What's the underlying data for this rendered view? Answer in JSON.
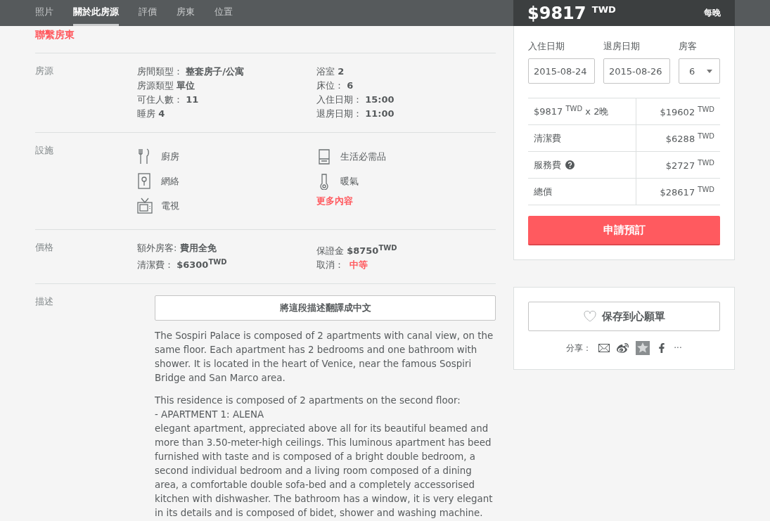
{
  "nav": {
    "tabs": [
      {
        "label": "照片",
        "selected": false
      },
      {
        "label": "關於此房源",
        "selected": true
      },
      {
        "label": "評價",
        "selected": false
      },
      {
        "label": "房東",
        "selected": false
      },
      {
        "label": "位置",
        "selected": false
      }
    ]
  },
  "contact_link": "聯繫房東",
  "sections": [
    {
      "kind": "details",
      "title": "房源",
      "columns": [
        [
          "房間類型： **整套房子/公寓**",
          "房源類型 **單位**",
          "可住人數： **11**",
          "睡房 **4**"
        ],
        [
          "浴室 **2**",
          "床位： **6**",
          "入住日期： **15:00**",
          "退房日期： **11:00**"
        ]
      ]
    },
    {
      "kind": "amenities",
      "title": "設施",
      "columns": [
        [
          {
            "kind": "kitchen",
            "label": "廚房"
          },
          {
            "kind": "internet",
            "label": "網絡"
          },
          {
            "kind": "tv",
            "label": "電視"
          }
        ],
        [
          {
            "kind": "essentials",
            "label": "生活必需品"
          },
          {
            "kind": "heating",
            "label": "暖氣"
          }
        ]
      ],
      "more": "更多內容"
    },
    {
      "kind": "prices",
      "title": "價格",
      "columns": [
        [
          {
            "text": "額外房客: **費用全免**"
          },
          {
            "text": "清潔費： **$6300$^{TWD}$**"
          }
        ],
        [
          {
            "text": "保證金 **$8750$^{TWD}$**"
          },
          {
            "text": "取消：",
            "highlight": "中等"
          }
        ]
      ]
    },
    {
      "kind": "description",
      "title": "描述",
      "translate_button": "將這段描述翻譯成中文",
      "paragraphs": [
        "The Sospiri Palace is composed of 2 apartments with canal view, on the same floor. Each apartment has 2 bedrooms and one bathroom with shower. It is located in the heart of Venice, near the famous Sospiri Bridge and San Marco area.",
        "This residence is composed of 2 apartments on the second floor:\n- APARTMENT 1: ALENA\nelegant apartment, appreciated above all for its beautiful beamed and more than 3.50-meter-high ceilings. This luminous apartment has beed furnished with taste and is composed of a bright double bedroom, a second individual bedroom and a living room composed of a dining area, a comfortable double sofa-bed and a completely accessorised kitchen with dishwasher. The bathroom has a window, it is very elegant in its details and is composed of bidet, shower and washing machine."
      ]
    }
  ],
  "booking": {
    "price": "$9817",
    "currency": "TWD",
    "per": "每晚",
    "fields": [
      {
        "kind": "date",
        "label": "入住日期",
        "value": "2015-08-24"
      },
      {
        "kind": "date",
        "label": "退房日期",
        "value": "2015-08-26"
      },
      {
        "kind": "select",
        "label": "房客",
        "value": "6"
      }
    ],
    "breakdown": [
      {
        "label": "$9817 $^{TWD}$ x 2晚",
        "value": "$19602 $^{TWD}$",
        "info": false
      },
      {
        "label": "清潔費",
        "value": "$6288 $^{TWD}$",
        "info": false
      },
      {
        "label": "服務費",
        "value": "$2727 $^{TWD}$",
        "info": true
      },
      {
        "label": "總價",
        "value": "$28617 $^{TWD}$",
        "info": false
      }
    ],
    "button": "申請預訂"
  },
  "wishlist": {
    "button": "保存到心願單",
    "share_label": "分享：",
    "share": [
      {
        "kind": "mail"
      },
      {
        "kind": "weibo"
      },
      {
        "kind": "qzone"
      },
      {
        "kind": "facebook"
      }
    ],
    "more": "···"
  }
}
